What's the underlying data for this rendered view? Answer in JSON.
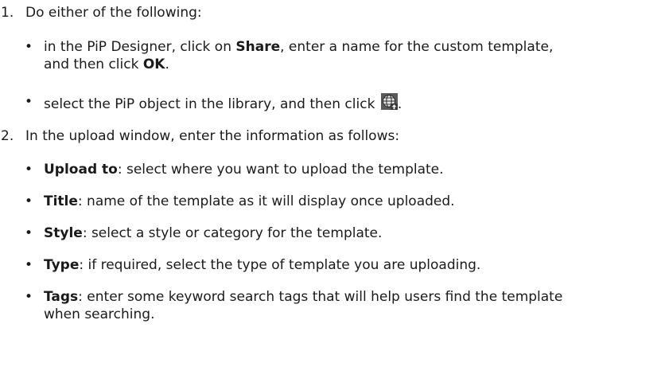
{
  "steps": [
    {
      "number": "1.",
      "text": "Do either of the following:"
    },
    {
      "number": "2.",
      "text": "In the upload window, enter the information as follows:"
    }
  ],
  "step1_bullets": {
    "b1": {
      "pre": "in the PiP Designer, click on ",
      "bold1": "Share",
      "mid": ", enter a name for the custom template,",
      "line2_pre": "and then click ",
      "bold2": "OK",
      "line2_post": "."
    },
    "b2": {
      "pre": "select the PiP object in the library, and then click ",
      "icon": "globe-upload-icon",
      "post": "."
    }
  },
  "step2_bullets": [
    {
      "term": "Upload to",
      "desc": ": select where you want to upload the template."
    },
    {
      "term": "Title",
      "desc": ": name of the template as it will display once uploaded."
    },
    {
      "term": "Style",
      "desc": ": select a style or category for the template."
    },
    {
      "term": "Type",
      "desc": ": if required, select the type of template you are uploading."
    },
    {
      "term": "Tags",
      "desc": ": enter some keyword search tags that will help users find the template",
      "line2": "when searching."
    }
  ],
  "bullet_glyph": "•",
  "icon_colors": {
    "dark": "#3a3a3a",
    "light": "#d9d9d9",
    "mid": "#8a8a8a"
  }
}
